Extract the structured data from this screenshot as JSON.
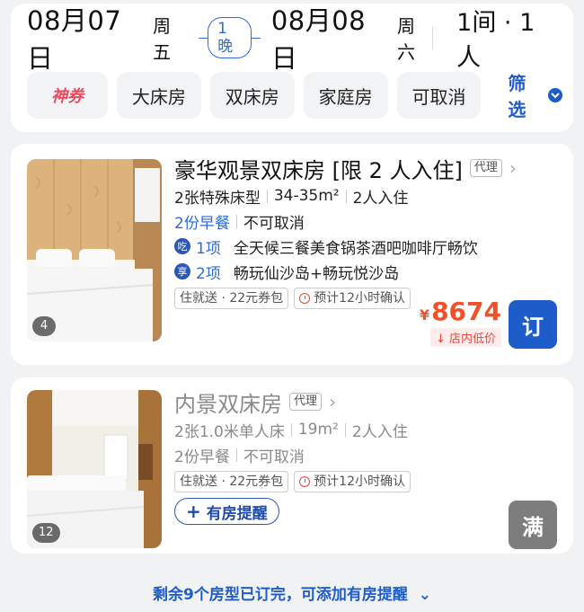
{
  "header": {
    "checkin_date": "08月07日",
    "checkin_weekday": "周五",
    "nights": "1晚",
    "checkout_date": "08月08日",
    "checkout_weekday": "周六",
    "rooms_guests": "1间 · 1人"
  },
  "filters": {
    "chips": [
      "神券",
      "大床房",
      "双床房",
      "家庭房",
      "可取消"
    ],
    "filter_label": "筛选"
  },
  "rooms": [
    {
      "title": "豪华观景双床房 [限 2 人入住]",
      "tag": "代理",
      "bed": "2张特殊床型",
      "area": "34-35m²",
      "capacity": "2人入住",
      "breakfast": "2份早餐",
      "cancel": "不可取消",
      "benefit1_icon": "吃",
      "benefit1_count": "1项",
      "benefit1_text": "全天候三餐美食锅茶酒吧咖啡厅畅饮",
      "benefit2_icon": "享",
      "benefit2_count": "2项",
      "benefit2_text": "畅玩仙沙岛+畅玩悦沙岛",
      "badge1": "住就送 · 22元券包",
      "badge2": "预计12小时确认",
      "currency": "¥",
      "price": "8674",
      "price_tag": "店内低价",
      "book_label": "订",
      "photo_count": "4"
    },
    {
      "title": "内景双床房",
      "tag": "代理",
      "bed": "2张1.0米单人床",
      "area": "19m²",
      "capacity": "2人入住",
      "breakfast": "2份早餐",
      "cancel": "不可取消",
      "badge1": "住就送 · 22元券包",
      "badge2": "预计12小时确认",
      "remind_label": "有房提醒",
      "full_label": "满",
      "photo_count": "12"
    }
  ],
  "footer": {
    "note": "剩余9个房型已订完，可添加有房提醒"
  }
}
